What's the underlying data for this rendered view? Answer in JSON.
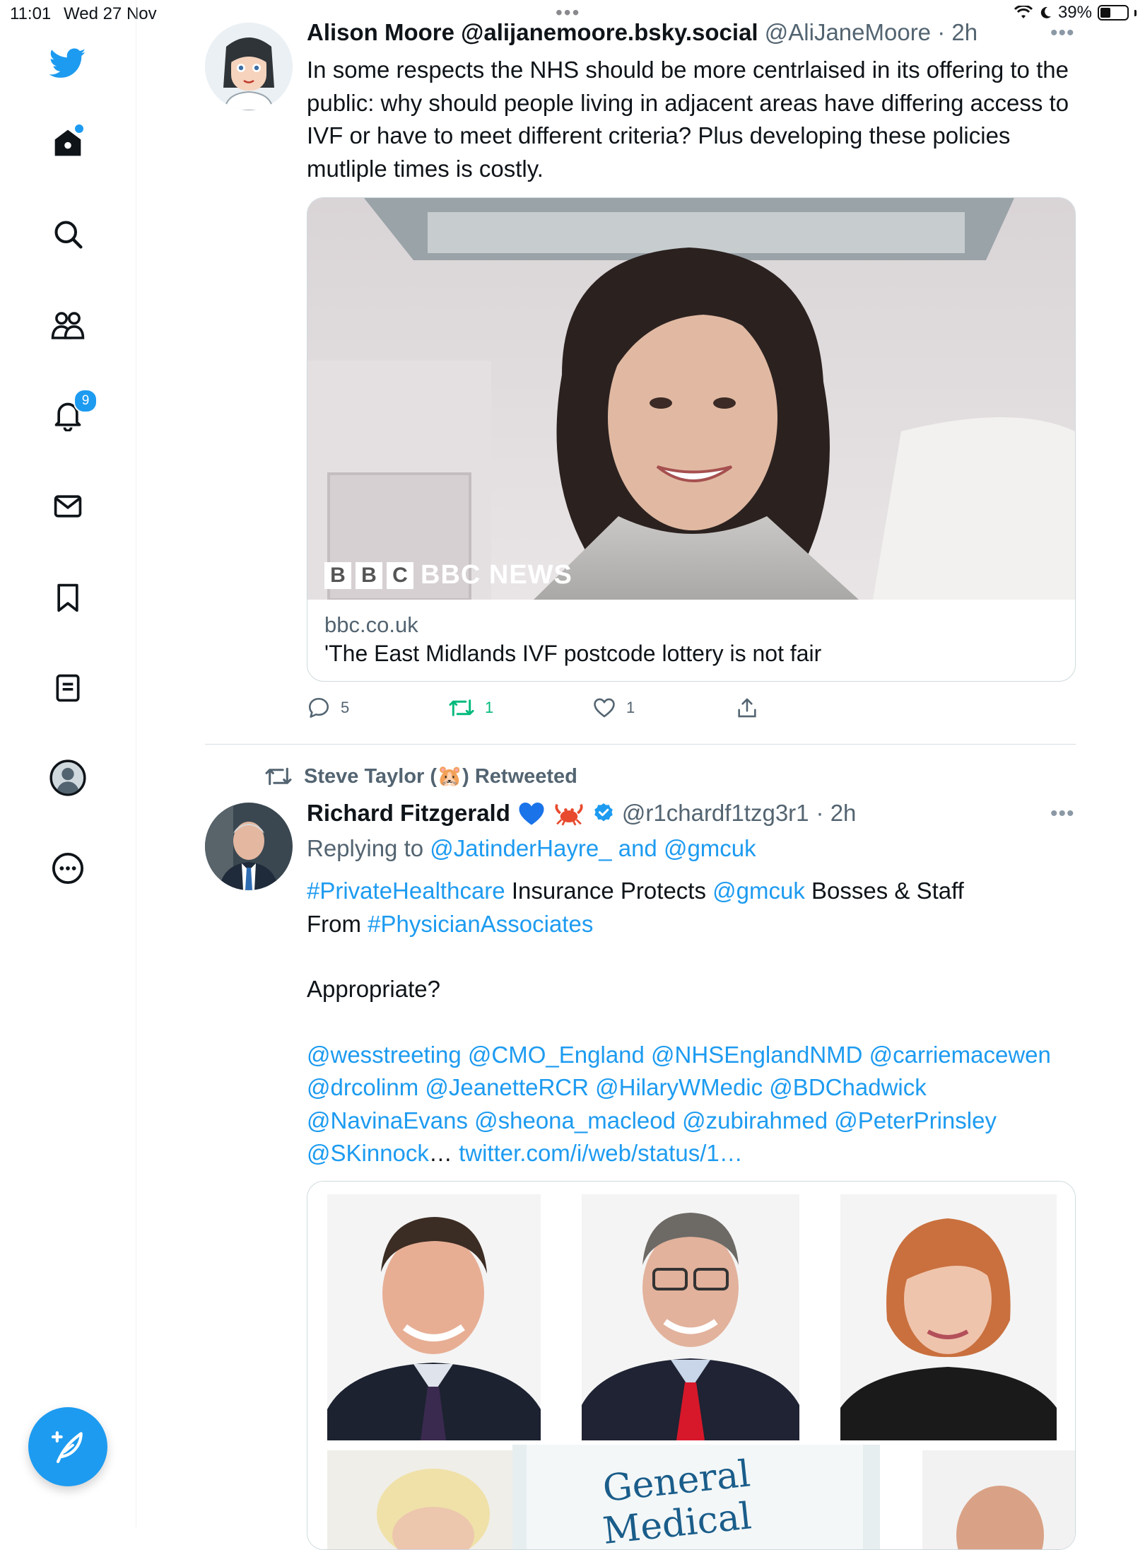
{
  "status_bar": {
    "time": "11:01",
    "date": "Wed 27 Nov",
    "battery": "39%",
    "battery_level": 0.39
  },
  "sidebar": {
    "items": [
      {
        "label": "Home",
        "icon": "home-icon"
      },
      {
        "label": "Explore",
        "icon": "search-icon"
      },
      {
        "label": "Communities",
        "icon": "people-icon"
      },
      {
        "label": "Notifications",
        "icon": "bell-icon",
        "badge": "9"
      },
      {
        "label": "Messages",
        "icon": "mail-icon"
      },
      {
        "label": "Bookmarks",
        "icon": "bookmark-icon"
      },
      {
        "label": "Lists",
        "icon": "list-icon"
      },
      {
        "label": "Profile",
        "icon": "profile-icon"
      },
      {
        "label": "More",
        "icon": "more-circle-icon"
      }
    ],
    "compose_icon": "feather-plus-icon",
    "accent": "#1d9bf0"
  },
  "tweet1": {
    "author": "Alison Moore @alijanemoore.bsky.social",
    "handle": "@AliJaneMoore",
    "time": "· 2h",
    "text": "In some respects the NHS should be more centrlaised in its offering to the public: why should people living in adjacent areas have differing access to IVF or have to meet different criteria? Plus developing these policies mutliple times is costly.",
    "card": {
      "image_caption": "BBC NEWS",
      "domain": "bbc.co.uk",
      "title": "'The East Midlands IVF postcode lottery is not fair"
    },
    "replies": "5",
    "retweets": "1",
    "likes": "1"
  },
  "tweet2": {
    "retweeted_by": "Steve Taylor (🐹) Retweeted",
    "author": "Richard Fitzgerald",
    "handle": "@r1chardf1tzg3r1",
    "time": "· 2h",
    "replying_to_prefix": "Replying to ",
    "replying_to": "@JatinderHayre_ and @gmcuk",
    "body1_tag": "#PrivateHealthcare",
    "body1_mid": " Insurance Protects ",
    "body1_mention": "@gmcuk",
    "body1_rest": " Bosses & Staff",
    "body2_from": "From ",
    "body2_tag": "#PhysicianAssociates",
    "body3": "Appropriate?",
    "mentions": "@wesstreeting @CMO_England @NHSEnglandNMD @carriemacewen @drcolinm @JeanetteRCR @HilaryWMedic @BDChadwick @NavinaEvans @sheona_macleod @zubirahmed @PeterPrinsley",
    "last_mention": "@SKinnock",
    "ellipsis": "…",
    "status_link": " twitter.com/i/web/status/1…",
    "sign_text": "General\nMedical"
  }
}
